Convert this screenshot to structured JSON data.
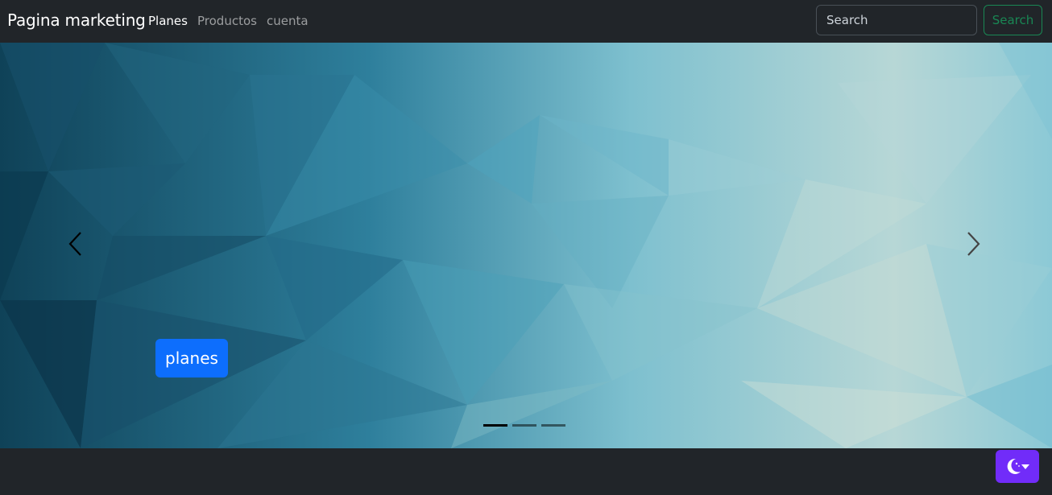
{
  "navbar": {
    "brand": "Pagina marketing",
    "links": [
      {
        "label": "Planes",
        "active": true
      },
      {
        "label": "Productos",
        "active": false
      },
      {
        "label": "cuenta",
        "active": false
      }
    ],
    "search": {
      "placeholder": "Search",
      "value": "",
      "button_label": "Search"
    }
  },
  "carousel": {
    "caption_button_label": "planes",
    "slide_count": 3,
    "active_slide": 1
  },
  "theme_toggle": {
    "icon": "moon-icon",
    "accent": "#712cf9"
  },
  "colors": {
    "navbar_bg": "#212529",
    "search_button": "#198754",
    "caption_button": "#0d6efd"
  }
}
